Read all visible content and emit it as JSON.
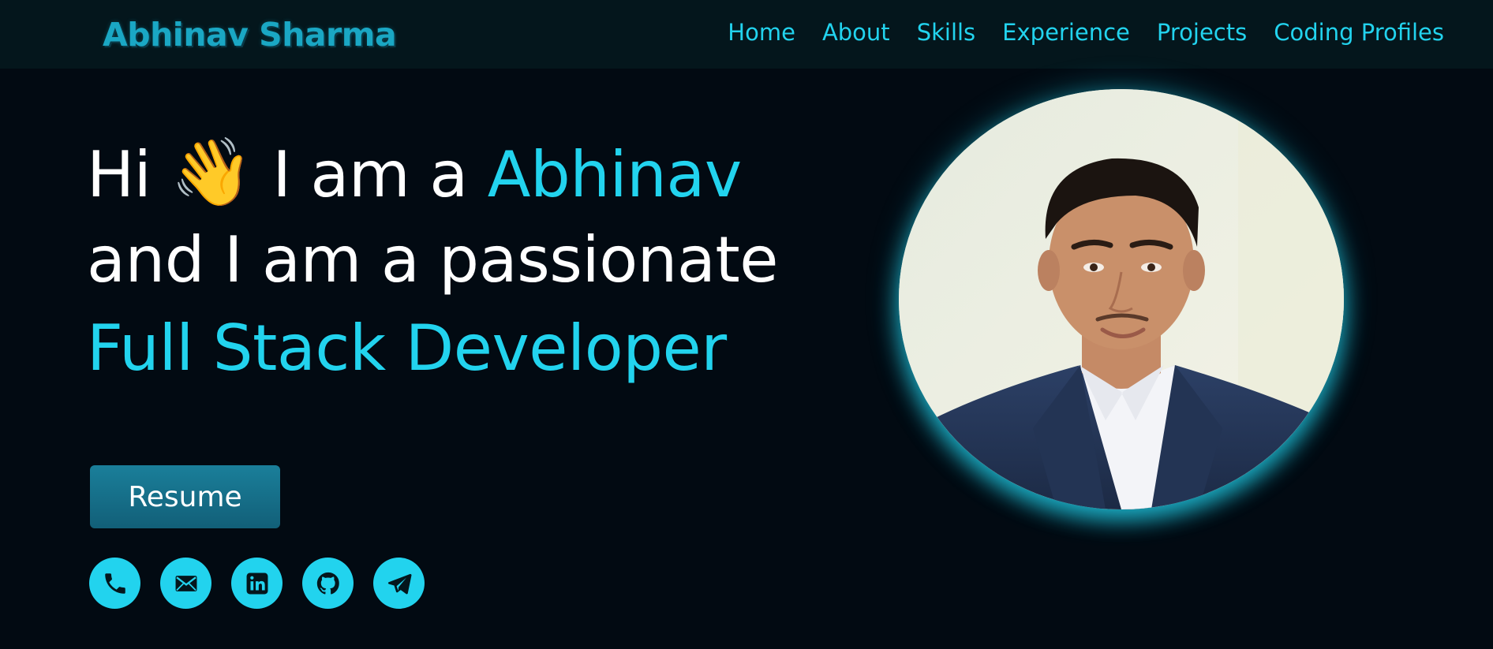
{
  "nav": {
    "brand": "Abhinav Sharma",
    "links": [
      {
        "label": "Home"
      },
      {
        "label": "About"
      },
      {
        "label": "Skills"
      },
      {
        "label": "Experience"
      },
      {
        "label": "Projects"
      },
      {
        "label": "Coding Profiles"
      }
    ]
  },
  "hero": {
    "greeting": "Hi",
    "wave_emoji": "👋",
    "intro": "I am a",
    "name": "Abhinav",
    "line2": "and I am a passionate",
    "role": "Full Stack Developer",
    "resume_label": "Resume"
  },
  "socials": [
    {
      "icon": "phone-icon"
    },
    {
      "icon": "mail-icon"
    },
    {
      "icon": "linkedin-icon"
    },
    {
      "icon": "github-icon"
    },
    {
      "icon": "telegram-icon"
    }
  ],
  "theme": {
    "background": "#020a12",
    "navbar": "#04161c",
    "accent": "#22d3ee",
    "button": "#1a7f9a"
  }
}
